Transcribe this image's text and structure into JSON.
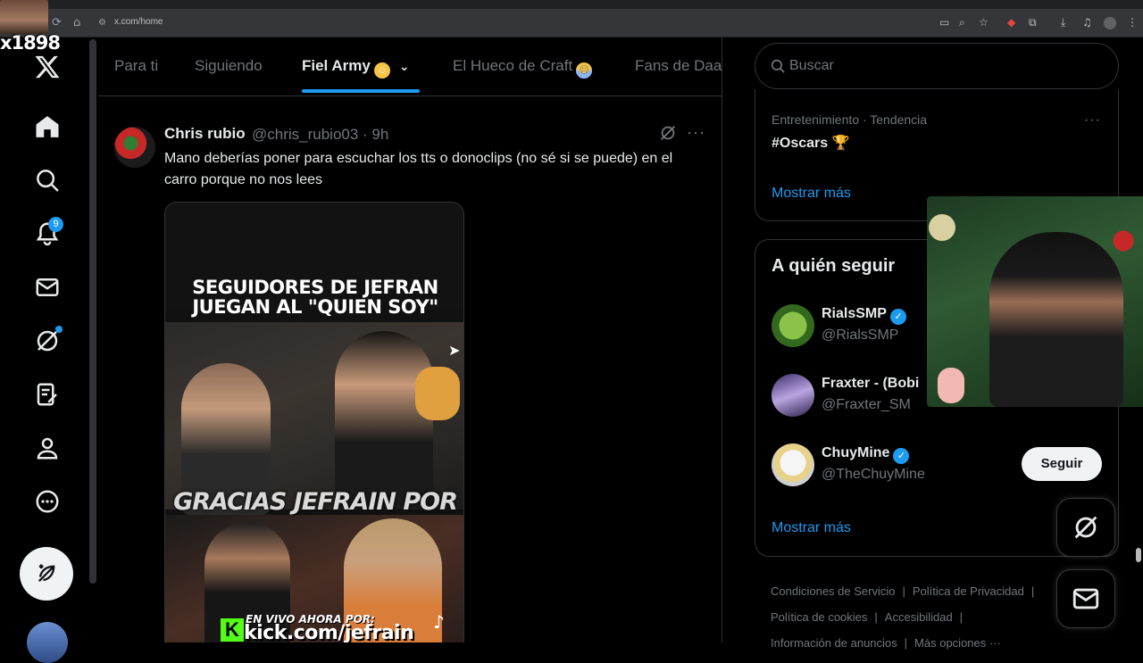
{
  "browser": {
    "url": "x.com/home"
  },
  "streamer_overlay": {
    "name": "x1898"
  },
  "nav": {
    "notifications_badge": "9"
  },
  "tabs": [
    {
      "label": "Para ti"
    },
    {
      "label": "Siguiendo"
    },
    {
      "label": "Fiel Army"
    },
    {
      "label": "El Hueco de Craft"
    },
    {
      "label": "Fans de Daa"
    }
  ],
  "tweet": {
    "author_name": "Chris rubio",
    "author_handle": "@chris_rubio03 · 9h",
    "text": "Mano deberías poner para escuchar los tts o donoclips (no sé si se puede) en el carro porque no nos lees",
    "media": {
      "title": "SEGUIDORES DE JEFRAN JUEGAN AL \"QUIEN SOY\"",
      "caption": "GRACIAS JEFRAIN POR",
      "live_text": "EN VIVO AHORA POR:",
      "url": "kick.com/jefrain"
    }
  },
  "search": {
    "placeholder": "Buscar"
  },
  "trend": {
    "meta": "Entretenimiento · Tendencia",
    "name": "#Oscars 🏆",
    "show_more": "Mostrar más"
  },
  "who_to_follow": {
    "title": "A quién seguir",
    "items": [
      {
        "name": "RialsSMP",
        "handle": "@RialsSMP",
        "verified": true
      },
      {
        "name": "Fraxter - (Bobi",
        "handle": "@Fraxter_SM",
        "verified": false
      },
      {
        "name": "ChuyMine",
        "handle": "@TheChuyMine",
        "verified": true,
        "button": "Seguir"
      }
    ],
    "show_more": "Mostrar más"
  },
  "footer": {
    "links": [
      "Condiciones de Servicio",
      "Política de Privacidad",
      "Política de cookies",
      "Accesibilidad",
      "Información de anuncios",
      "Más opciones ···"
    ]
  },
  "colors": {
    "accent": "#1d9bf0",
    "background": "#000000",
    "text": "#e7e9ea",
    "muted": "#71767b",
    "border": "#2f3336"
  }
}
